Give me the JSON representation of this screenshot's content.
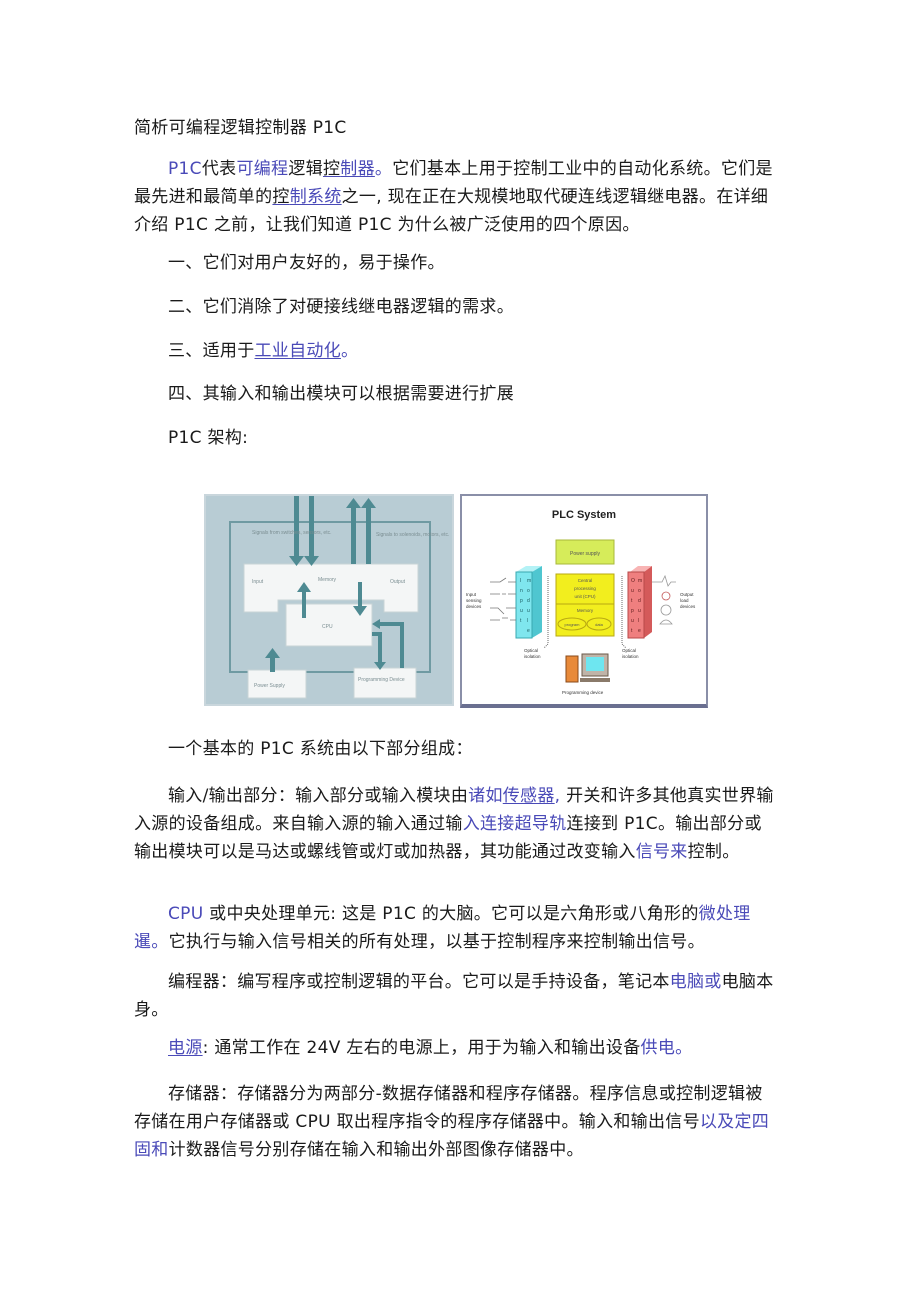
{
  "document": {
    "title": "简析可编程逻辑控制器 P1C",
    "intro": {
      "segments": [
        {
          "text": "P1C",
          "style": "link"
        },
        {
          "text": "代表",
          "style": "plain"
        },
        {
          "text": "可编程",
          "style": "link"
        },
        {
          "text": "逻辑",
          "style": "plain"
        },
        {
          "text": "控",
          "style": "underline"
        },
        {
          "text": "制器",
          "style": "link-underline"
        },
        {
          "text": "。",
          "style": "link"
        },
        {
          "text": "它们基本上用于控制工业中的自动化系统。它们是最先进和最简单的",
          "style": "plain"
        },
        {
          "text": "控",
          "style": "underline"
        },
        {
          "text": "制系统",
          "style": "link-underline"
        },
        {
          "text": "之一, 现在正在大规模地取代硬连线逻辑继电器。在详细介绍 P1C 之前，让我们知道 P1C 为什么被广泛使用的四个原因。",
          "style": "plain"
        }
      ]
    },
    "reasons": [
      {
        "text": "一、它们对用户友好的，易于操作。"
      },
      {
        "text": "二、它们消除了对硬接线继电器逻辑的需求。"
      },
      {
        "prefix": "三、适用于",
        "link": "工业自动化",
        "suffix": "。"
      },
      {
        "text": "四、其输入和输出模块可以根据需要进行扩展"
      }
    ],
    "architecture_label": "P1C 架构:",
    "figure_left": {
      "signals_in": "Signals from switches, sensors, etc.",
      "signals_out": "Signals to solenoids, motors, etc.",
      "input": "Input",
      "memory": "Memory",
      "output": "Output",
      "cpu": "CPU",
      "power_supply": "Power Supply",
      "programming_device": "Programming Device"
    },
    "figure_right": {
      "title": "PLC System",
      "power_supply": "Power supply",
      "cpu_line1": "Central",
      "cpu_line2": "processing",
      "cpu_line3": "unit (CPU)",
      "memory": "Memory",
      "program": "program",
      "data": "data",
      "input_devices_1": "Input",
      "input_devices_2": "sensing",
      "input_devices_3": "devices",
      "output_devices_1": "Output",
      "output_devices_2": "load",
      "output_devices_3": "devices",
      "optical_1": "Optical",
      "optical_2": "isolation",
      "programming_device": "Programming device",
      "input_module_letters": [
        "I",
        "n",
        "p",
        "u",
        "t"
      ],
      "output_module_letters": [
        "O",
        "u",
        "t",
        "p",
        "u",
        "t"
      ],
      "module_word": [
        "m",
        "o",
        "d",
        "u",
        "l",
        "e"
      ]
    },
    "basic_system": "一个基本的 P1C 系统由以下部分组成：",
    "io_section": {
      "segments": [
        {
          "text": "输入/输出部分：输入部分或输入模块由",
          "style": "plain"
        },
        {
          "text": "诸如",
          "style": "link"
        },
        {
          "text": "传感器",
          "style": "link-underline"
        },
        {
          "text": ",",
          "style": "link"
        },
        {
          "text": " 开关和许多其他真实世界输入源的设备组成。来自输入源的输入通过输",
          "style": "plain"
        },
        {
          "text": "入连接超导轨",
          "style": "link"
        },
        {
          "text": "连接到 P1C。输出部分或输出模块可以是马达或螺线管或灯或加热器，其功能通过改变输入",
          "style": "plain"
        },
        {
          "text": "信号来",
          "style": "link"
        },
        {
          "text": "控制。",
          "style": "plain"
        }
      ]
    },
    "cpu_section": {
      "segments": [
        {
          "text": "CPU",
          "style": "link"
        },
        {
          "text": " 或中央处理单元: 这是 P1C 的大脑。它可以是六角形或八角形的",
          "style": "plain"
        },
        {
          "text": "微处理暹。",
          "style": "link"
        },
        {
          "text": "它执行与输入信号相关的所有处理，以基于控制程序来控制输出信号。",
          "style": "plain"
        }
      ]
    },
    "programmer_section": {
      "segments": [
        {
          "text": "编程器：编写程序或控制逻辑的平台。它可以是手持设备，笔记本",
          "style": "plain"
        },
        {
          "text": "电脑或",
          "style": "link"
        },
        {
          "text": "电脑本身。",
          "style": "plain"
        }
      ]
    },
    "power_section": {
      "segments": [
        {
          "text": "电源",
          "style": "link-underline"
        },
        {
          "text": ": 通常工作在 24V 左右的电源上，用于为输入和输出设备",
          "style": "plain"
        },
        {
          "text": "供电。",
          "style": "link"
        }
      ]
    },
    "memory_section": {
      "segments": [
        {
          "text": "存储器：存储器分为两部分-数据存储器和程序存储器。程序信息或控制逻辑被存储在用户存储器或 CPU 取出程序指令的程序存储器中。输入和输出信号",
          "style": "plain"
        },
        {
          "text": "以及定四固和",
          "style": "link"
        },
        {
          "text": "计数器信号分别存储在输入和输出外部图像存储器中。",
          "style": "plain"
        }
      ]
    }
  },
  "colors": {
    "text": "#1a1a1a",
    "link": "#4a4ab8",
    "figure_left_bg": "#b8ccd4",
    "figure_left_arrow": "#4e8a92",
    "input_module": "#7fe6ee",
    "output_module": "#ef7f7f",
    "cpu_block": "#f2ee1e",
    "power_block": "#d6ec5a"
  }
}
